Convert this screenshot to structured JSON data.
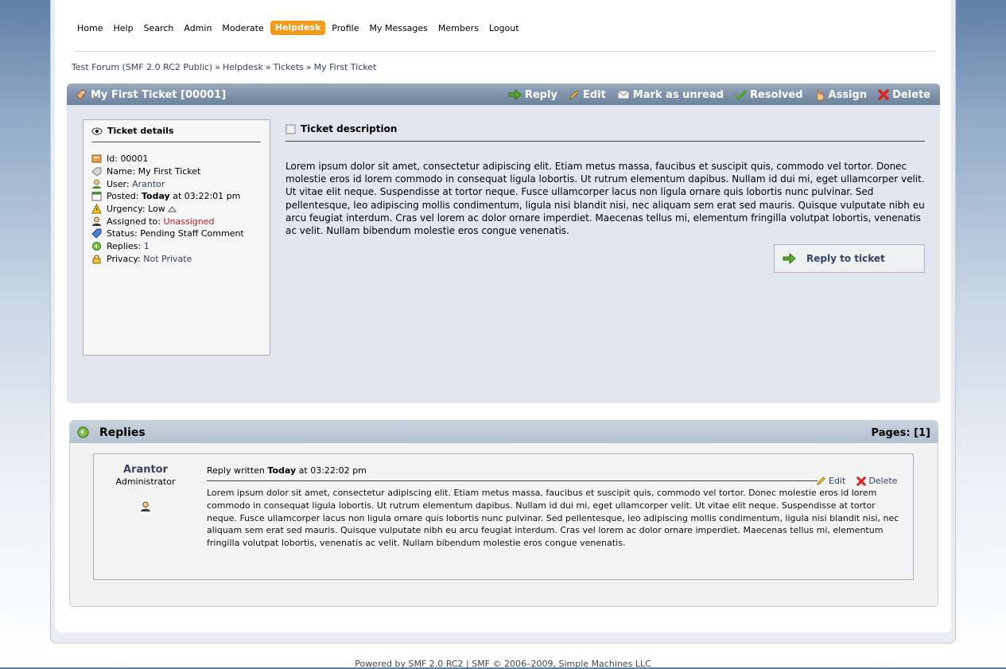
{
  "menu": {
    "items": [
      {
        "label": "Home"
      },
      {
        "label": "Help"
      },
      {
        "label": "Search"
      },
      {
        "label": "Admin"
      },
      {
        "label": "Moderate"
      },
      {
        "label": "Helpdesk",
        "active": true
      },
      {
        "label": "Profile"
      },
      {
        "label": "My Messages"
      },
      {
        "label": "Members"
      },
      {
        "label": "Logout"
      }
    ]
  },
  "breadcrumb": [
    "Test Forum (SMF 2.0 RC2 Public)",
    "Helpdesk",
    "Tickets",
    "My First Ticket"
  ],
  "breadcrumb_sep": "»",
  "ticket": {
    "title": "My First Ticket [00001]",
    "actions": {
      "reply": "Reply",
      "edit": "Edit",
      "mark_unread": "Mark as unread",
      "resolved": "Resolved",
      "assign": "Assign",
      "delete": "Delete"
    },
    "details": {
      "heading": "Ticket details",
      "id_label": "Id:",
      "id": "00001",
      "name_label": "Name:",
      "name": "My First Ticket",
      "user_label": "User:",
      "user": "Arantor",
      "posted_label": "Posted:",
      "posted_day": "Today",
      "posted_time": "at 03:22:01 pm",
      "urgency_label": "Urgency:",
      "urgency": "Low",
      "assigned_label": "Assigned to:",
      "assigned": "Unassigned",
      "status_label": "Status:",
      "status": "Pending Staff Comment",
      "replies_label": "Replies:",
      "replies": "1",
      "privacy_label": "Privacy:",
      "privacy": "Not Private"
    },
    "description_heading": "Ticket description",
    "description": "Lorem ipsum dolor sit amet, consectetur adipiscing elit. Etiam metus massa, faucibus et suscipit quis, commodo vel tortor. Donec molestie eros id lorem commodo in consequat ligula lobortis. Ut rutrum elementum dapibus. Nullam id dui mi, eget ullamcorper velit. Ut vitae elit neque. Suspendisse at tortor neque. Fusce ullamcorper lacus non ligula ornare quis lobortis nunc pulvinar. Sed pellentesque, leo adipiscing mollis condimentum, ligula nisi blandit nisi, nec aliquam sem erat sed mauris. Quisque vulputate nibh eu arcu feugiat interdum. Cras vel lorem ac dolor ornare imperdiet. Maecenas tellus mi, elementum fringilla volutpat lobortis, venenatis ac velit. Nullam bibendum molestie eros congue venenatis.",
    "reply_button": "Reply to ticket"
  },
  "replies": {
    "heading": "Replies",
    "pages": "Pages: [1]",
    "items": [
      {
        "poster": "Arantor",
        "role": "Administrator",
        "meta_prefix": "Reply written",
        "meta_day": "Today",
        "meta_time": "at 03:22:02 pm",
        "edit": "Edit",
        "delete": "Delete",
        "body": "Lorem ipsum dolor sit amet, consectetur adipiscing elit. Etiam metus massa, faucibus et suscipit quis, commodo vel tortor. Donec molestie eros id lorem commodo in consequat ligula lobortis. Ut rutrum elementum dapibus. Nullam id dui mi, eget ullamcorper velit. Ut vitae elit neque. Suspendisse at tortor neque. Fusce ullamcorper lacus non ligula ornare quis lobortis nunc pulvinar. Sed pellentesque, leo adipiscing mollis condimentum, ligula nisi blandit nisi, nec aliquam sem erat sed mauris. Quisque vulputate nibh eu arcu feugiat interdum. Cras vel lorem ac dolor ornare imperdiet. Maecenas tellus mi, elementum fringilla volutpat lobortis, venenatis ac velit. Nullam bibendum molestie eros congue venenatis."
      }
    ]
  },
  "footer": "Powered by SMF 2.0 RC2 | SMF © 2006–2009, Simple Machines LLC",
  "colors": {
    "accent": "#f39a1b",
    "link": "#334466",
    "alert": "#c4161c",
    "header": "#7f93ab"
  }
}
